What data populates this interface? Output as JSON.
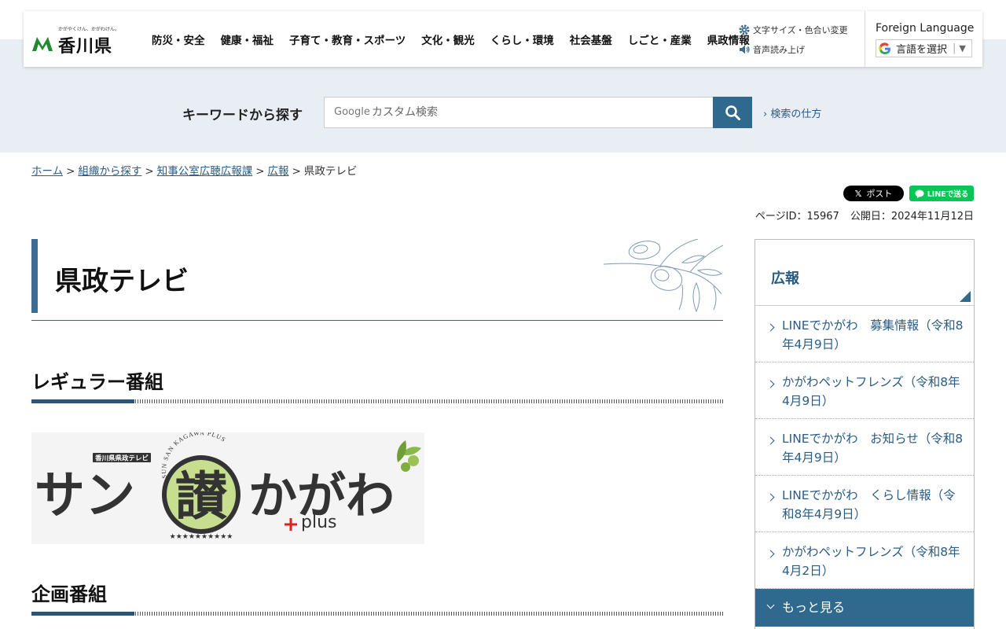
{
  "header": {
    "logo_tagline": "かがやくけん、かがわけん。",
    "logo_name": "香川県",
    "nav": [
      "防災・安全",
      "健康・福祉",
      "子育て・教育・スポーツ",
      "文化・観光",
      "くらし・環境",
      "社会基盤",
      "しごと・産業",
      "県政情報"
    ],
    "tools": {
      "text_size": "文字サイズ・色合い変更",
      "read_aloud": "音声読み上げ"
    },
    "foreign_language": {
      "title": "Foreign Language",
      "select_label": "言語を選択"
    }
  },
  "search": {
    "label": "キーワードから探す",
    "brand": "Google",
    "placeholder": "カスタム検索",
    "howto": "検索の仕方"
  },
  "breadcrumb": [
    "ホーム",
    "組織から探す",
    "知事公室広聴広報課",
    "広報",
    "県政テレビ"
  ],
  "share": {
    "x_label": "ポスト",
    "line_label": "LINEで送る"
  },
  "meta": {
    "page_id": "ページID：15967",
    "published": "公開日：2024年11月12日"
  },
  "main": {
    "title": "県政テレビ",
    "section1": "レギュラー番組",
    "banner": {
      "small_label": "香川県県政テレビ",
      "arc_text": "SUN SAN KAGAWA PLUS",
      "title_left": "サン",
      "title_circle": "讃",
      "title_right": "かがわ",
      "plus_text": "plus"
    },
    "section2": "企画番組"
  },
  "sidebar": {
    "title": "広報",
    "items": [
      "LINEでかがわ　募集情報（令和8年4月9日）",
      "かがわペットフレンズ（令和8年4月9日）",
      "LINEでかがわ　お知らせ（令和8年4月9日）",
      "LINEでかがわ　くらし情報（令和8年4月9日）",
      "かがわペットフレンズ（令和8年4月2日）"
    ],
    "more": "もっと見る"
  },
  "colors": {
    "accent": "#2f6a8e",
    "link": "#2a5c86",
    "band": "#e8eef4"
  }
}
